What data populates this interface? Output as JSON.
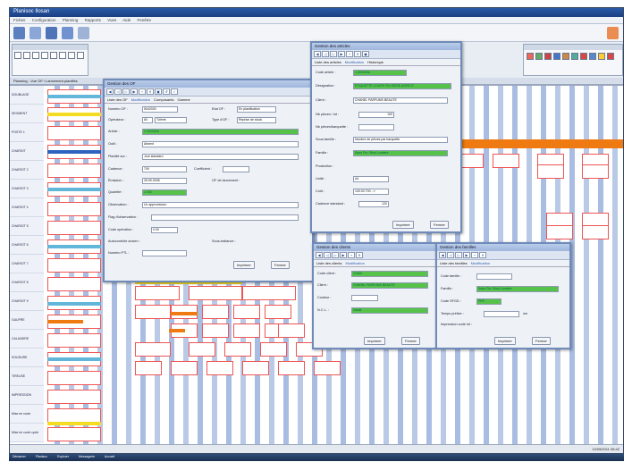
{
  "window": {
    "title": "Planisoc Ilosan"
  },
  "menu": [
    "Fichier",
    "Configuration",
    "Planning",
    "Rapports",
    "Vues",
    "Aide",
    "Fenêtre"
  ],
  "tabs_panel": {
    "label": "Planning - Vue OF / Lancement planifiés"
  },
  "rows": [
    "DOUBLAGE",
    "SEGMENT",
    "POSTE 1",
    "CHARIOT",
    "CHARIOT 2",
    "CHARIOT 3",
    "CHARIOT 4",
    "CHARIOT 5",
    "CHARIOT 6",
    "CHARIOT 7",
    "CHARIOT 8",
    "CHARIOT 9",
    "GAUFRE",
    "CALANDRE",
    "SOUDURE",
    "TIREUSE",
    "IMPRESSION",
    "Mise en route",
    "Mise en route cycle"
  ],
  "status": {
    "datetime": "13/09/2011 08:42"
  },
  "taskbar": [
    "Démarrer",
    "Planisoc",
    "Explorer",
    "Messagerie",
    "Accueil"
  ],
  "win_of": {
    "title": "Gestion des OF",
    "tabs": [
      "Liste des OF",
      "Modification",
      "Composants",
      "Gamme"
    ],
    "labels": {
      "num": "Numéro OF :",
      "opr": "Opérateur :",
      "article": "Article :",
      "outil": "Outil :",
      "planif": "Planifié sur :",
      "cadence": "Cadence :",
      "emission": "Émission :",
      "quantite": "Quantité :",
      "observ": "Observation :",
      "flag": "Flag d'observation :",
      "code_operation": "Code opération :",
      "autocontrol": "Autocontrôle ancien :",
      "num_ptl": "Numéro PTL :",
      "etat": "Etat OF :",
      "type": "Type d'OF :",
      "coef": "Coefficient :",
      "lancement": "OF de lancement :",
      "sf": "Sous-traitance :"
    },
    "values": {
      "num": "5042003",
      "opr": "60",
      "opr_name": "Tôlerie",
      "article": "1 000000A",
      "outil": "Absent",
      "planif": "Jour standard",
      "cadence": "700",
      "emission": "25.09.2008",
      "quantite": "1 000",
      "observ": "Un approvisionn.",
      "code_operation": "0.00",
      "etat": "En planification",
      "type": "Reprise de stock"
    },
    "buttons": {
      "print": "Imprimer",
      "ok": "Fermer"
    }
  },
  "win_art": {
    "title": "Gestion des articles",
    "tabs": [
      "Liste des articles",
      "Modification",
      "Historique"
    ],
    "labels": {
      "code": "Code article :",
      "desig": "Désignation :",
      "client": "Client :",
      "nb_lot": "Nb pièces / lot :",
      "nb_barq": "Nb pièces/barquette :",
      "sf": "Sous-famille :",
      "famille": "Famille :",
      "prod": "Production :",
      "unite": "Unité :",
      "cout": "Coût :",
      "cadence": "Cadence standard :"
    },
    "values": {
      "code": "1 000000A",
      "desig": "ETIQUETTE COUPE FIN SERIE ASPECT",
      "client": "CHANEL PARFUMS BEAUTE",
      "nb_lot": "100",
      "nb_barq": "",
      "sf": "Nombre de pièces par barquette",
      "famille": "Sans Fin / Roul.Lumière",
      "unite": "A4",
      "cout": "100.00 700 - ¤",
      "cadence": "120"
    },
    "buttons": {
      "print": "Imprimer",
      "ok": "Fermer"
    }
  },
  "win_cli": {
    "title": "Gestion des clients",
    "tabs": [
      "Liste des clients",
      "Modification"
    ],
    "labels": {
      "code": "Code client :",
      "client": "Client :",
      "couleur": "Couleur :",
      "ncl": "N.C.L. :"
    },
    "values": {
      "code": "CHAN",
      "client": "CHANEL PARFUMS BEAUTE",
      "ncl": "Validé"
    },
    "buttons": {
      "print": "Imprimer",
      "ok": "Fermer"
    }
  },
  "win_fam": {
    "title": "Gestion des familles",
    "tabs": [
      "Liste des familles",
      "Modification"
    ],
    "labels": {
      "code": "Code famille :",
      "famille": "Famille :",
      "code_sfgd": "Code SFGD :",
      "temps": "Temps préfixe :",
      "lot": "Impression code lot :"
    },
    "values": {
      "famille": "Sans Fin / Roul.Lumière",
      "code_sfgd": "PRF",
      "temps_unit": "mn"
    },
    "buttons": {
      "print": "Imprimer",
      "ok": "Fermer"
    }
  },
  "colors": {
    "accent": "#2f5fb0",
    "green": "#57c24a",
    "orange": "#f07a12",
    "red": "#e55454",
    "yellow": "#f5dc24"
  }
}
